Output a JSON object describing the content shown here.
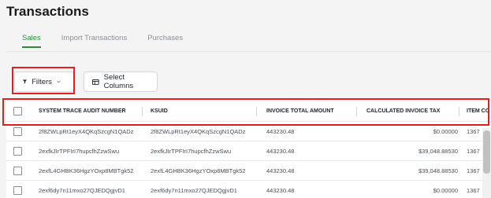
{
  "page": {
    "title": "Transactions"
  },
  "tabs": [
    {
      "label": "Sales",
      "active": true
    },
    {
      "label": "Import Transactions",
      "active": false
    },
    {
      "label": "Purchases",
      "active": false
    }
  ],
  "toolbar": {
    "filters_label": "Filters",
    "filter_icon": "funnel-icon",
    "filters_chevron_icon": "chevron-down-icon",
    "select_columns_label": "Select Columns",
    "columns_icon": "columns-icon"
  },
  "table": {
    "columns": [
      "SYSTEM TRACE AUDIT NUMBER",
      "KSUID",
      "INVOICE TOTAL AMOUNT",
      "CALCULATED INVOICE TAX",
      "ITEM CO"
    ],
    "rows": [
      {
        "stan": "2f8ZWLpRt1eyX4QKqSzcgN1QADz",
        "ksuid": "2f8ZWLpRt1eyX4QKqSzcgN1QADz",
        "amount": "443230.48",
        "tax": "$0.00000",
        "item": "1367"
      },
      {
        "stan": "2exfkJIrTPFIrI7hupcfhZzwSwu",
        "ksuid": "2exfkJIrTPFIrI7hupcfhZzwSwu",
        "amount": "443230.48",
        "tax": "$39,048.88530",
        "item": "1367"
      },
      {
        "stan": "2exfL4GHBK36HgzYOxp8MBTgk52",
        "ksuid": "2exfL4GHBK36HgzYOxp8MBTgk52",
        "amount": "443230.48",
        "tax": "$39,048.88530",
        "item": "1367"
      },
      {
        "stan": "2exf6dy7n11mxo27QJEDQgjvD1",
        "ksuid": "2exf6dy7n11mxo27QJEDQgjvD1",
        "amount": "443230.48",
        "tax": "$0.00000",
        "item": "1367"
      }
    ]
  },
  "colors": {
    "accent": "#2e8b3e",
    "highlight": "#e02020"
  }
}
